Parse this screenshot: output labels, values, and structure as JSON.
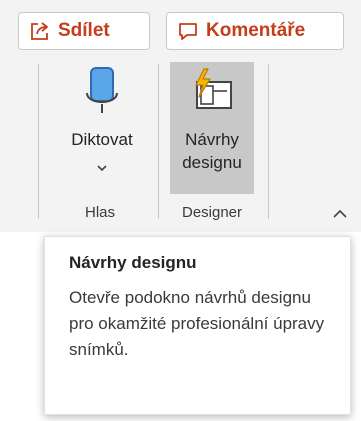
{
  "buttons": {
    "share_label": "Sdílet",
    "comments_label": "Komentáře"
  },
  "commands": {
    "dictate_label": "Diktovat",
    "design_label_line1": "Návrhy",
    "design_label_line2": "designu"
  },
  "groups": {
    "voice": "Hlas",
    "designer": "Designer"
  },
  "tooltip": {
    "title": "Návrhy designu",
    "body": "Otevře podokno návrhů designu pro okamžité profesionální úpravy snímků."
  },
  "colors": {
    "accent": "#c43e1c",
    "ribbon_bg": "#f3f3f3",
    "selected_bg": "#c8c8c8"
  },
  "icons": [
    "share-icon",
    "comment-icon",
    "microphone-icon",
    "chevron-down-icon",
    "design-ideas-icon",
    "collapse-ribbon-icon"
  ]
}
